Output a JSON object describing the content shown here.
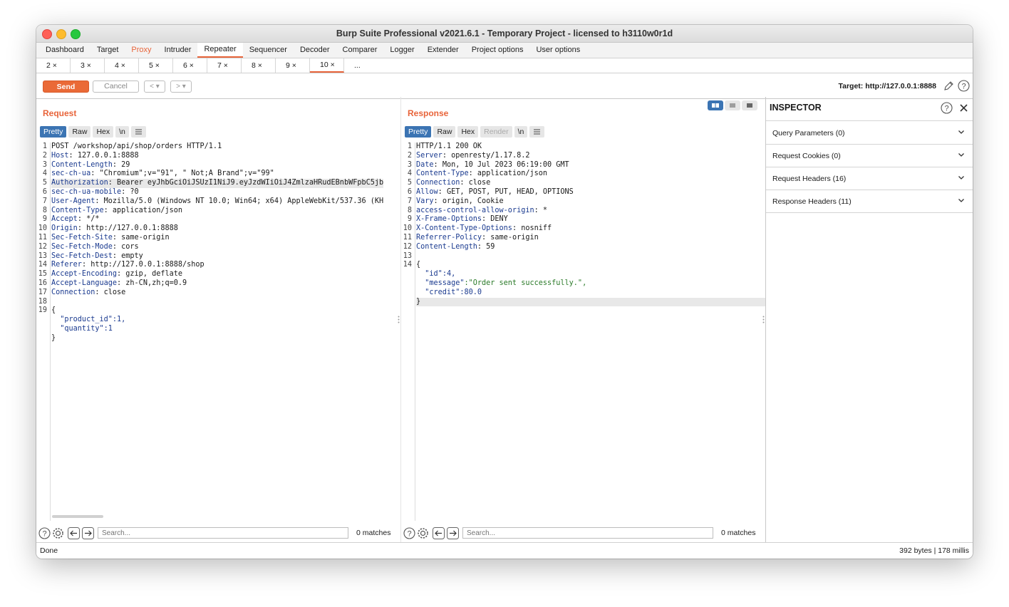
{
  "window": {
    "title": "Burp Suite Professional v2021.6.1 - Temporary Project - licensed to h3110w0r1d"
  },
  "main_tabs": [
    "Dashboard",
    "Target",
    "Proxy",
    "Intruder",
    "Repeater",
    "Sequencer",
    "Decoder",
    "Comparer",
    "Logger",
    "Extender",
    "Project options",
    "User options"
  ],
  "sub_tabs": [
    "2 ×",
    "3 ×",
    "4 ×",
    "5 ×",
    "6 ×",
    "7 ×",
    "8 ×",
    "9 ×",
    "10 ×",
    "..."
  ],
  "toolbar": {
    "send": "Send",
    "cancel": "Cancel",
    "prev": "<",
    "next": ">",
    "dropdown": "▾",
    "target": "Target: http://127.0.0.1:8888"
  },
  "request": {
    "title": "Request",
    "formats": [
      "Pretty",
      "Raw",
      "Hex",
      "\\n"
    ],
    "lines": [
      {
        "n": "1",
        "k": "",
        "v": "POST /workshop/api/shop/orders HTTP/1.1"
      },
      {
        "n": "2",
        "k": "Host",
        "v": ": 127.0.0.1:8888"
      },
      {
        "n": "3",
        "k": "Content-Length",
        "v": ": 29"
      },
      {
        "n": "4",
        "k": "sec-ch-ua",
        "v": ": \"Chromium\";v=\"91\", \" Not;A Brand\";v=\"99\""
      },
      {
        "n": "5",
        "k": "Authorization",
        "v": ": Bearer eyJhbGciOiJSUzI1NiJ9.eyJzdWIiOiJ4ZmlzaHRudEBnbWFpbC5jb"
      },
      {
        "n": "6",
        "k": "sec-ch-ua-mobile",
        "v": ": ?0"
      },
      {
        "n": "7",
        "k": "User-Agent",
        "v": ": Mozilla/5.0 (Windows NT 10.0; Win64; x64) AppleWebKit/537.36 (KH"
      },
      {
        "n": "8",
        "k": "Content-Type",
        "v": ": application/json"
      },
      {
        "n": "9",
        "k": "Accept",
        "v": ": */*"
      },
      {
        "n": "10",
        "k": "Origin",
        "v": ": http://127.0.0.1:8888"
      },
      {
        "n": "11",
        "k": "Sec-Fetch-Site",
        "v": ": same-origin"
      },
      {
        "n": "12",
        "k": "Sec-Fetch-Mode",
        "v": ": cors"
      },
      {
        "n": "13",
        "k": "Sec-Fetch-Dest",
        "v": ": empty"
      },
      {
        "n": "14",
        "k": "Referer",
        "v": ": http://127.0.0.1:8888/shop"
      },
      {
        "n": "15",
        "k": "Accept-Encoding",
        "v": ": gzip, deflate"
      },
      {
        "n": "16",
        "k": "Accept-Language",
        "v": ": zh-CN,zh;q=0.9"
      },
      {
        "n": "17",
        "k": "Connection",
        "v": ": close"
      },
      {
        "n": "18",
        "k": "",
        "v": ""
      },
      {
        "n": "19",
        "k": "",
        "v": "{"
      },
      {
        "n": "",
        "k": "  \"product_id\"",
        "v": ":1,"
      },
      {
        "n": "",
        "k": "  \"quantity\"",
        "v": ":1"
      },
      {
        "n": "",
        "k": "",
        "v": "}"
      }
    ],
    "search_placeholder": "Search...",
    "matches": "0 matches"
  },
  "response": {
    "title": "Response",
    "formats": [
      "Pretty",
      "Raw",
      "Hex",
      "Render",
      "\\n"
    ],
    "lines": [
      {
        "n": "1",
        "k": "",
        "v": "HTTP/1.1 200 OK"
      },
      {
        "n": "2",
        "k": "Server",
        "v": ": openresty/1.17.8.2"
      },
      {
        "n": "3",
        "k": "Date",
        "v": ": Mon, 10 Jul 2023 06:19:00 GMT"
      },
      {
        "n": "4",
        "k": "Content-Type",
        "v": ": application/json"
      },
      {
        "n": "5",
        "k": "Connection",
        "v": ": close"
      },
      {
        "n": "6",
        "k": "Allow",
        "v": ": GET, POST, PUT, HEAD, OPTIONS"
      },
      {
        "n": "7",
        "k": "Vary",
        "v": ": origin, Cookie"
      },
      {
        "n": "8",
        "k": "access-control-allow-origin",
        "v": ": *"
      },
      {
        "n": "9",
        "k": "X-Frame-Options",
        "v": ": DENY"
      },
      {
        "n": "10",
        "k": "X-Content-Type-Options",
        "v": ": nosniff"
      },
      {
        "n": "11",
        "k": "Referrer-Policy",
        "v": ": same-origin"
      },
      {
        "n": "12",
        "k": "Content-Length",
        "v": ": 59"
      },
      {
        "n": "13",
        "k": "",
        "v": ""
      },
      {
        "n": "14",
        "k": "",
        "v": "{"
      },
      {
        "n": "",
        "k": "  \"id\"",
        "v": ":4,"
      },
      {
        "n": "",
        "k": "  \"message\"",
        "v": ":\"Order sent successfully.\","
      },
      {
        "n": "",
        "k": "  \"credit\"",
        "v": ":80.0"
      },
      {
        "n": "",
        "k": "",
        "v": "}"
      }
    ],
    "search_placeholder": "Search...",
    "matches": "0 matches"
  },
  "inspector": {
    "title": "INSPECTOR",
    "sections": [
      "Query Parameters (0)",
      "Request Cookies (0)",
      "Request Headers (16)",
      "Response Headers (11)"
    ]
  },
  "status": {
    "left": "Done",
    "right": "392 bytes | 178 millis"
  },
  "colors": {
    "accent": "#e8643a",
    "selected_format": "#3b74b3",
    "header_key": "#1a3a8f",
    "json_string": "#2a7a28"
  },
  "icons": [
    "help-icon",
    "gear-icon",
    "back-arrow-icon",
    "forward-arrow-icon",
    "pencil-icon",
    "close-icon",
    "chevron-down-icon"
  ]
}
